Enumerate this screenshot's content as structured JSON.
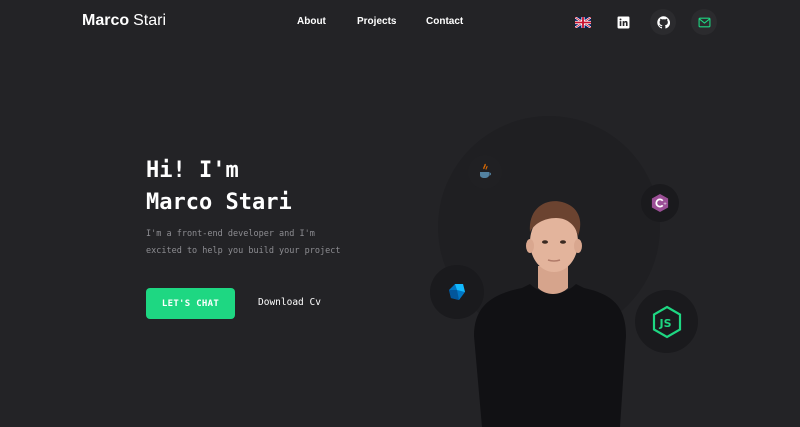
{
  "header": {
    "logo_first": "Marco",
    "logo_last": "Stari",
    "nav": [
      "About",
      "Projects",
      "Contact"
    ],
    "icons": [
      "uk-flag-icon",
      "linkedin-icon",
      "github-icon",
      "mail-icon"
    ]
  },
  "hero": {
    "title_line1": "Hi! I'm",
    "title_line2": "Marco Stari",
    "subtitle_line1": "I'm a front-end developer and I'm",
    "subtitle_line2": "excited to help you build your project",
    "cta_label": "LET'S CHAT",
    "cv_label": "Download Cv"
  },
  "tech_badges": [
    "java-icon",
    "csharp-icon",
    "dart-icon",
    "nodejs-icon"
  ],
  "colors": {
    "background": "#232326",
    "accent": "#1ed782",
    "text": "#ffffff",
    "muted": "#8d8d92"
  }
}
